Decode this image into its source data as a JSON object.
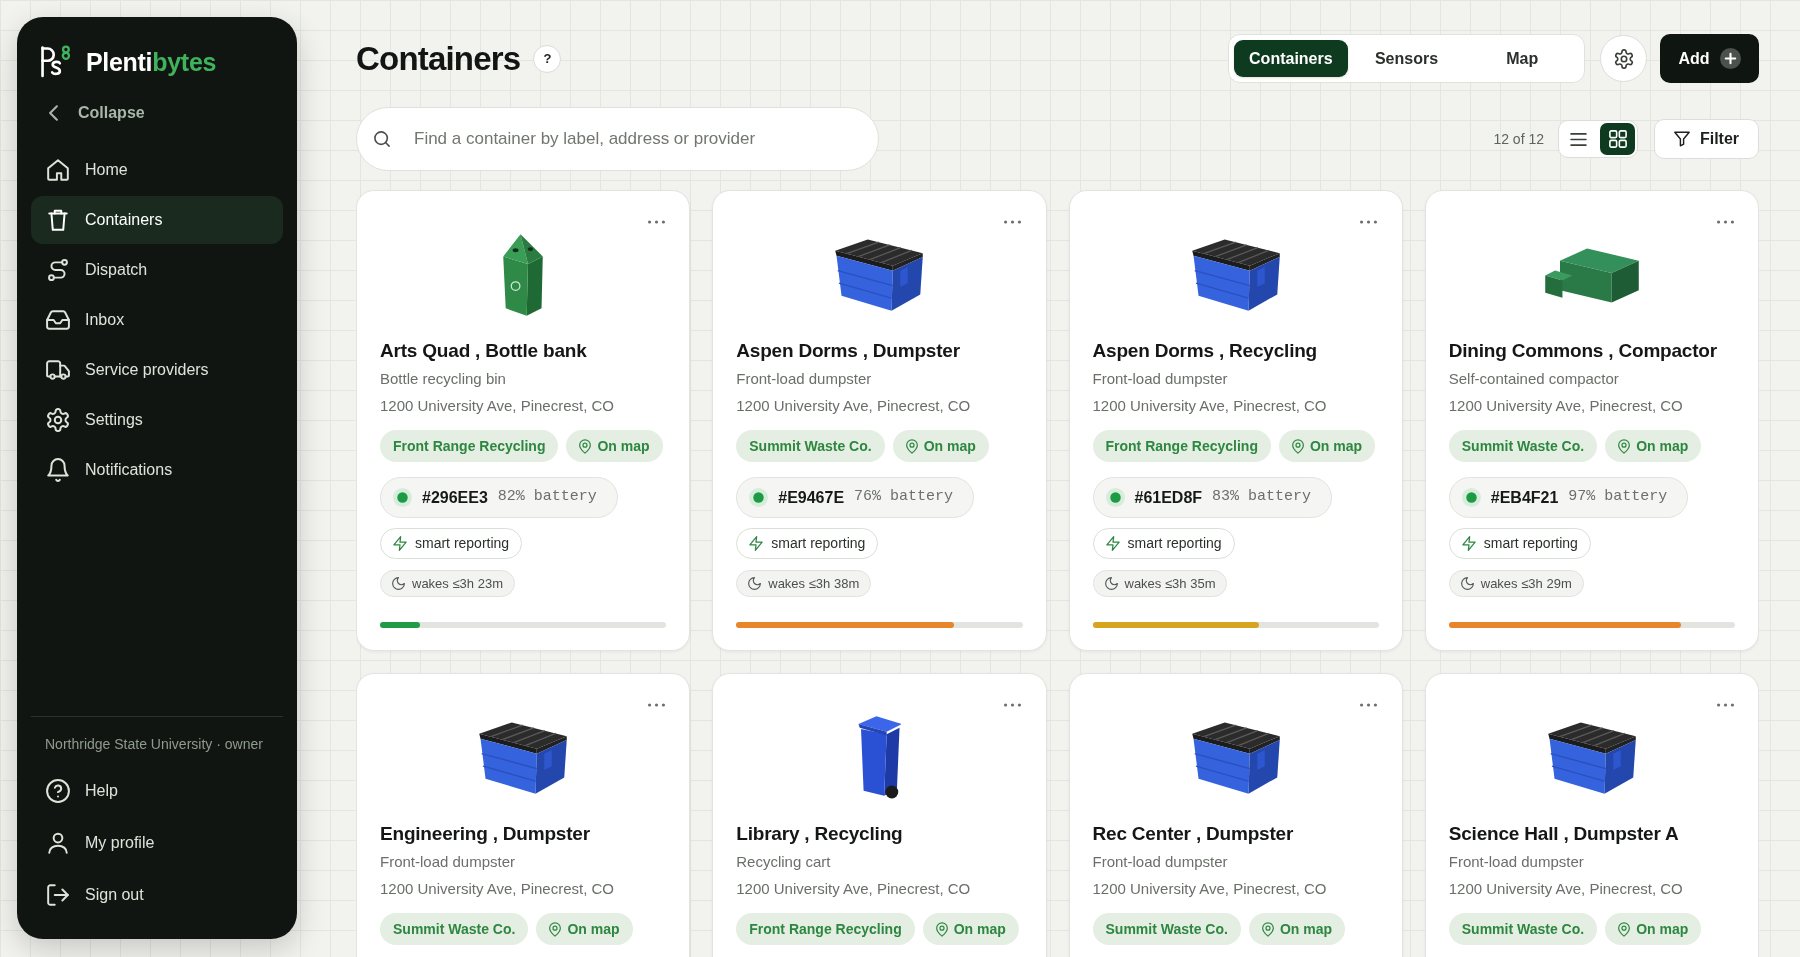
{
  "sidebar": {
    "brand": {
      "text": "Plenti",
      "accent": "bytes"
    },
    "collapse": "Collapse",
    "items": [
      {
        "label": "Home",
        "selected": false
      },
      {
        "label": "Containers",
        "selected": true
      },
      {
        "label": "Dispatch",
        "selected": false
      },
      {
        "label": "Inbox",
        "selected": false
      },
      {
        "label": "Service providers",
        "selected": false
      },
      {
        "label": "Settings",
        "selected": false
      },
      {
        "label": "Notifications",
        "selected": false
      }
    ],
    "account": "Northridge State University · owner",
    "footer_items": [
      {
        "label": "Help"
      },
      {
        "label": "My profile"
      },
      {
        "label": "Sign out"
      }
    ]
  },
  "header": {
    "title": "Containers",
    "help": "?",
    "tabs": [
      {
        "label": "Containers",
        "selected": true
      },
      {
        "label": "Sensors",
        "selected": false
      },
      {
        "label": "Map",
        "selected": false
      }
    ],
    "add_button": "Add"
  },
  "toolbar": {
    "search": {
      "placeholder": "Find a container by label, address or provider"
    },
    "count": "12 of 12",
    "view_modes": [
      {
        "selected": false
      },
      {
        "selected": true
      }
    ],
    "filter_button": "Filter"
  },
  "cards": [
    {
      "kind": "bottle-bin",
      "title": "Arts Quad , Bottle bank",
      "subtitle": "Bottle recycling bin",
      "address": "1200 University Ave, Pinecrest, CO",
      "provider": "Front Range Recycling",
      "map_link": "On map",
      "sensor": {
        "id": "#296EE3",
        "battery": "82% battery"
      },
      "reporting": "smart reporting",
      "wakes": "wakes ≤3h 23m",
      "fill": {
        "level": 0.14,
        "color": "#1f9a45"
      }
    },
    {
      "kind": "dumpster",
      "title": "Aspen Dorms , Dumpster",
      "subtitle": "Front-load dumpster",
      "address": "1200 University Ave, Pinecrest, CO",
      "provider": "Summit Waste Co.",
      "map_link": "On map",
      "sensor": {
        "id": "#E9467E",
        "battery": "76% battery"
      },
      "reporting": "smart reporting",
      "wakes": "wakes ≤3h 38m",
      "fill": {
        "level": 0.76,
        "color": "#e8852b"
      }
    },
    {
      "kind": "dumpster",
      "title": "Aspen Dorms , Recycling",
      "subtitle": "Front-load dumpster",
      "address": "1200 University Ave, Pinecrest, CO",
      "provider": "Front Range Recycling",
      "map_link": "On map",
      "sensor": {
        "id": "#61ED8F",
        "battery": "83% battery"
      },
      "reporting": "smart reporting",
      "wakes": "wakes ≤3h 35m",
      "fill": {
        "level": 0.58,
        "color": "#d6a41e"
      }
    },
    {
      "kind": "compactor",
      "title": "Dining Commons , Compactor",
      "subtitle": "Self-contained compactor",
      "address": "1200 University Ave, Pinecrest, CO",
      "provider": "Summit Waste Co.",
      "map_link": "On map",
      "sensor": {
        "id": "#EB4F21",
        "battery": "97% battery"
      },
      "reporting": "smart reporting",
      "wakes": "wakes ≤3h 29m",
      "fill": {
        "level": 0.81,
        "color": "#e8852b"
      }
    },
    {
      "kind": "dumpster",
      "title": "Engineering , Dumpster",
      "subtitle": "Front-load dumpster",
      "address": "1200 University Ave, Pinecrest, CO",
      "provider": "Summit Waste Co.",
      "map_link": "On map"
    },
    {
      "kind": "cart",
      "title": "Library , Recycling",
      "subtitle": "Recycling cart",
      "address": "1200 University Ave, Pinecrest, CO",
      "provider": "Front Range Recycling",
      "map_link": "On map"
    },
    {
      "kind": "dumpster",
      "title": "Rec Center , Dumpster",
      "subtitle": "Front-load dumpster",
      "address": "1200 University Ave, Pinecrest, CO",
      "provider": "Summit Waste Co.",
      "map_link": "On map"
    },
    {
      "kind": "dumpster",
      "title": "Science Hall , Dumpster A",
      "subtitle": "Front-load dumpster",
      "address": "1200 University Ave, Pinecrest, CO",
      "provider": "Summit Waste Co.",
      "map_link": "On map"
    }
  ]
}
